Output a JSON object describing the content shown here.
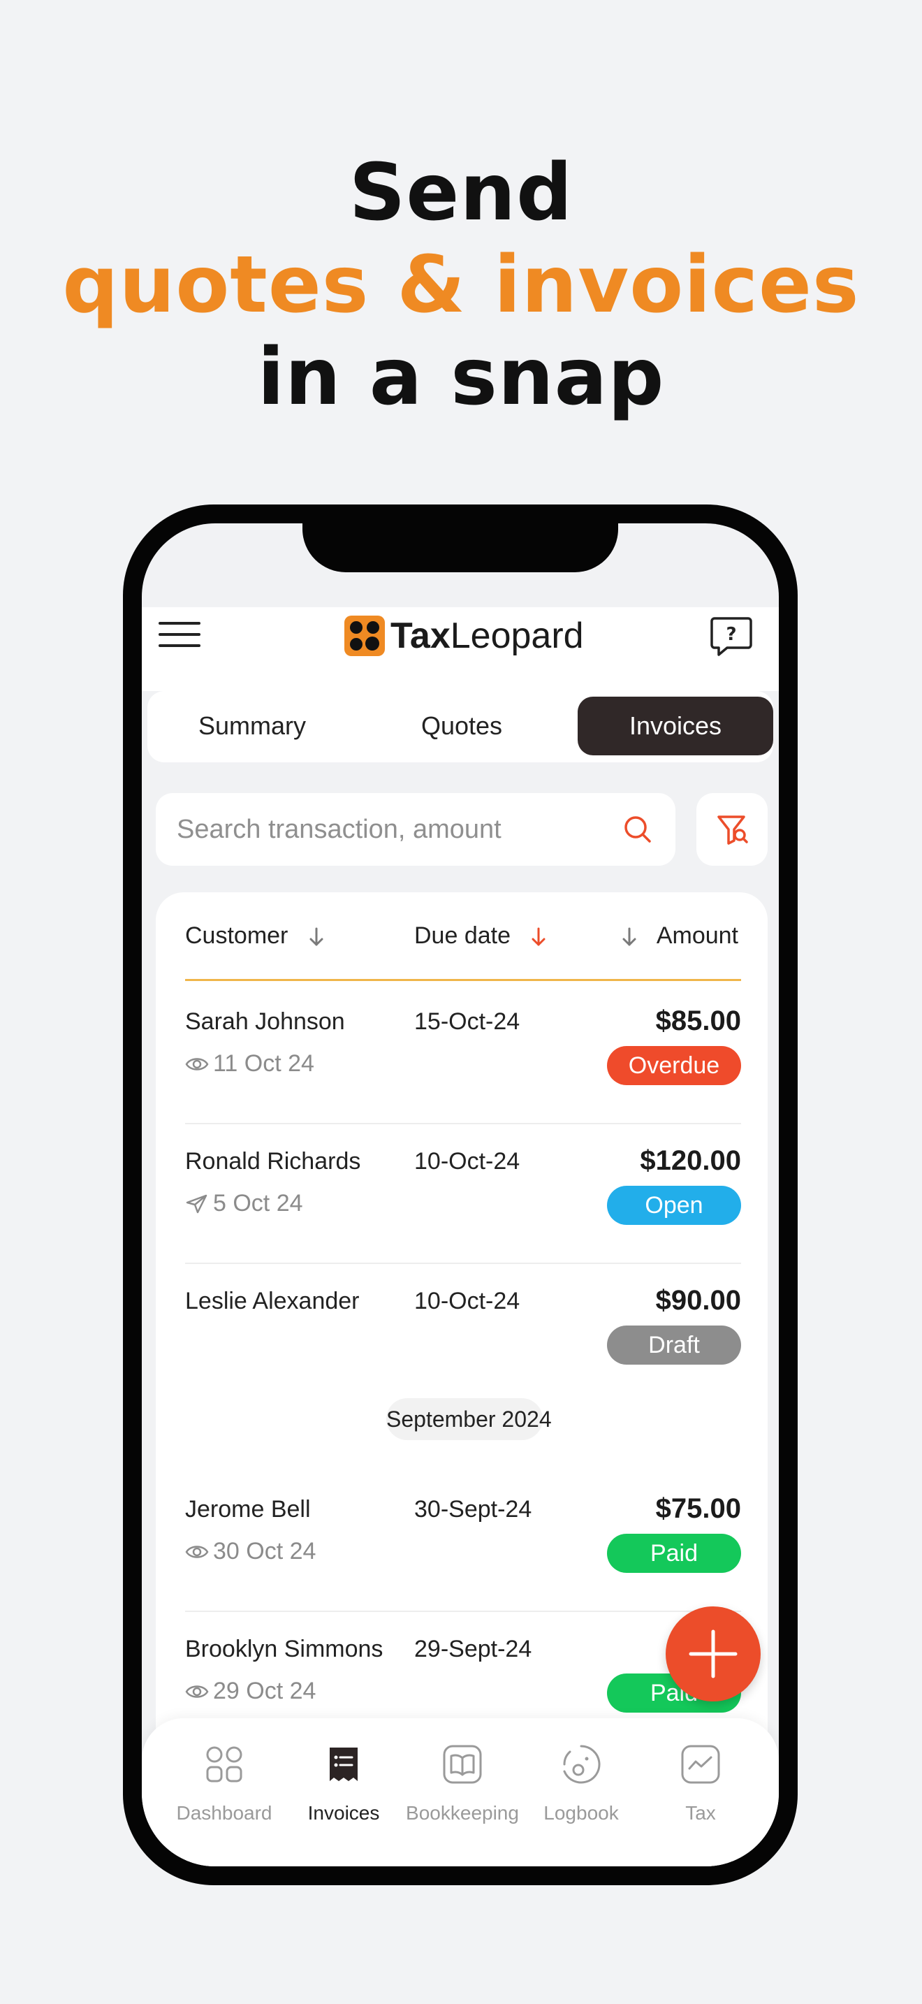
{
  "headline": {
    "line1": "Send",
    "line2": "quotes & invoices",
    "line3": "in a snap"
  },
  "app": {
    "logo_bold": "Tax",
    "logo_regular": "Leopard"
  },
  "tabs": [
    {
      "label": "Summary",
      "active": false
    },
    {
      "label": "Quotes",
      "active": false
    },
    {
      "label": "Invoices",
      "active": true
    }
  ],
  "search": {
    "placeholder": "Search transaction, amount"
  },
  "table": {
    "headers": {
      "customer": "Customer",
      "due_date": "Due date",
      "amount": "Amount"
    },
    "month_divider": "September 2024",
    "rows": [
      {
        "customer": "Sarah Johnson",
        "due": "15-Oct-24",
        "amount": "$85.00",
        "sub_icon": "eye-icon",
        "sub": "11 Oct 24",
        "status": "Overdue",
        "status_color": "#ef4b2b"
      },
      {
        "customer": "Ronald Richards",
        "due": "10-Oct-24",
        "amount": "$120.00",
        "sub_icon": "send-icon",
        "sub": "5 Oct 24",
        "status": "Open",
        "status_color": "#22aeea"
      },
      {
        "customer": "Leslie Alexander",
        "due": "10-Oct-24",
        "amount": "$90.00",
        "sub_icon": "",
        "sub": "",
        "status": "Draft",
        "status_color": "#8d8d8d"
      },
      {
        "customer": "Jerome Bell",
        "due": "30-Sept-24",
        "amount": "$75.00",
        "sub_icon": "eye-icon",
        "sub": "30 Oct 24",
        "status": "Paid",
        "status_color": "#14c85a"
      },
      {
        "customer": "Brooklyn Simmons",
        "due": "29-Sept-24",
        "amount": "$",
        "sub_icon": "eye-icon",
        "sub": "29 Oct 24",
        "status": "Paid",
        "status_color": "#14c85a"
      }
    ]
  },
  "bottom_nav": [
    {
      "label": "Dashboard",
      "icon": "grid-icon",
      "active": false
    },
    {
      "label": "Invoices",
      "icon": "receipt-icon",
      "active": true
    },
    {
      "label": "Bookkeeping",
      "icon": "book-icon",
      "active": false
    },
    {
      "label": "Logbook",
      "icon": "odometer-icon",
      "active": false
    },
    {
      "label": "Tax",
      "icon": "chart-icon",
      "active": false
    }
  ],
  "colors": {
    "brand_orange": "#ef8a23",
    "accent_red": "#ec4d2a",
    "dark": "#302828"
  }
}
